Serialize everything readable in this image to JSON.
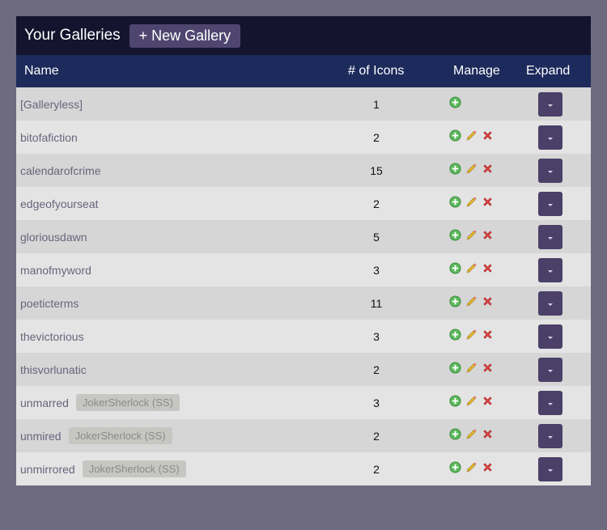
{
  "title": "Your Galleries",
  "new_gallery_label": "+ New Gallery",
  "columns": {
    "name": "Name",
    "count": "# of Icons",
    "manage": "Manage",
    "expand": "Expand"
  },
  "icons": {
    "add": "add-icon",
    "edit": "pencil-edit-icon",
    "delete": "delete-x-icon",
    "expand": "chevron-down-icon"
  },
  "rows": [
    {
      "name": "[Galleryless]",
      "tag": null,
      "count": "1",
      "editable": false
    },
    {
      "name": "bitofafiction",
      "tag": null,
      "count": "2",
      "editable": true
    },
    {
      "name": "calendarofcrime",
      "tag": null,
      "count": "15",
      "editable": true
    },
    {
      "name": "edgeofyourseat",
      "tag": null,
      "count": "2",
      "editable": true
    },
    {
      "name": "gloriousdawn",
      "tag": null,
      "count": "5",
      "editable": true
    },
    {
      "name": "manofmyword",
      "tag": null,
      "count": "3",
      "editable": true
    },
    {
      "name": "poeticterms",
      "tag": null,
      "count": "11",
      "editable": true
    },
    {
      "name": "thevictorious",
      "tag": null,
      "count": "3",
      "editable": true
    },
    {
      "name": "thisvorlunatic",
      "tag": null,
      "count": "2",
      "editable": true
    },
    {
      "name": "unmarred",
      "tag": "JokerSherlock (SS)",
      "count": "3",
      "editable": true
    },
    {
      "name": "unmired",
      "tag": "JokerSherlock (SS)",
      "count": "2",
      "editable": true
    },
    {
      "name": "unmirrored",
      "tag": "JokerSherlock (SS)",
      "count": "2",
      "editable": true
    }
  ]
}
